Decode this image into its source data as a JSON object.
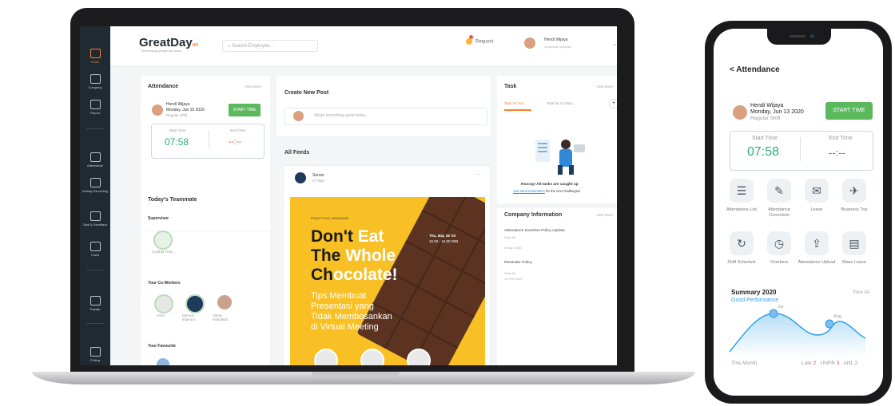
{
  "laptop": {
    "sidebar": [
      {
        "label": "Home",
        "active": true
      },
      {
        "label": "Company",
        "active": false
      },
      {
        "label": "Report",
        "active": false
      },
      {
        "label": "Attendance",
        "active": false
      },
      {
        "label": "Activity Recording",
        "active": false
      },
      {
        "label": "Task & Feedback",
        "active": false
      },
      {
        "label": "Claim",
        "active": false
      },
      {
        "label": "Payslip",
        "active": false
      },
      {
        "label": "Polling",
        "active": false
      }
    ],
    "header": {
      "logo": "GreatDay",
      "logo_mark": "HR",
      "logo_sub": "The everyday people care about",
      "search_placeholder": "Search Employee...",
      "request_label": "Request",
      "user_name": "Hendi Wijaya",
      "user_role": "Graphical Designer"
    },
    "attendance": {
      "title": "Attendance",
      "view_more": "View More",
      "name": "Hendi Wijaya",
      "date": "Monday, Jun 15 2020",
      "shift": "Regular Shift",
      "start_button": "START TIME",
      "start_label": "Start Time",
      "start_value": "07:58",
      "end_label": "End Time",
      "end_value": "--:--"
    },
    "teammate": {
      "title": "Today's Teammate",
      "supervisor_label": "Supervisor",
      "supervisor_name": "Cynthia Tirta...",
      "coworkers_label": "Your Co-Workers",
      "coworkers": [
        "Irsan",
        "Monica khairuni...",
        "Varna Harbaktio"
      ],
      "favourite_label": "Your Favourite"
    },
    "feed": {
      "create_title": "Create New Post",
      "create_placeholder": "Share something great today...",
      "all_feeds": "All Feeds",
      "poster_name": "Seruni",
      "poster_date": "27 May",
      "more": "...",
      "promo_tag": "PRACTICAL WEBINAR",
      "promo_line1_dark": "Don't",
      "promo_line1_white": "Eat",
      "promo_line2_dark": "The",
      "promo_line2_white": "Whole",
      "promo_line3_dark": "Ch",
      "promo_line3_white": "ocolate!",
      "promo_sub1": "Tips Membuat",
      "promo_sub2": "Presentasi yang",
      "promo_sub3": "Tidak Membosankan",
      "promo_sub4": "di Virtual Meeting",
      "promo_date": "Thu, May 28 '20",
      "promo_time": "15.00 - 16.00 WIB"
    },
    "task": {
      "title": "Task",
      "view_more": "View More",
      "tab_you": "Task for You",
      "tab_coworkers": "Task for Co-Wor...",
      "caught_up": "Hooray! All tasks are caught up",
      "caught_sub_link": "Just send teammates",
      "caught_sub_rest": "for the next challenges!",
      "company_title": "Company Information",
      "company_view": "View More",
      "items": [
        {
          "title": "Attendance Incentive Policy Update",
          "who": "Dear All,",
          "date": "09 Apr 2020"
        },
        {
          "title": "Reminder Policy",
          "who": "Dear All,",
          "date": "13 Feb 2019"
        }
      ]
    }
  },
  "phone": {
    "title": "< Attendance",
    "name": "Hendi Wijaya",
    "date": "Monday, Jun 13 2020",
    "shift": "Regular Shift",
    "start_button": "START TIME",
    "start_label": "Start Time",
    "start_value": "07:58",
    "end_label": "End Time",
    "end_value": "--:--",
    "features": [
      {
        "icon": "attendance-list-icon",
        "glyph": "☰",
        "label": "Attendance List"
      },
      {
        "icon": "attendance-correction-icon",
        "glyph": "✎",
        "label": "Attendance Correction"
      },
      {
        "icon": "leave-icon",
        "glyph": "✉",
        "label": "Leave"
      },
      {
        "icon": "business-trip-icon",
        "glyph": "✈",
        "label": "Business Trip"
      },
      {
        "icon": "shift-schedule-icon",
        "glyph": "↻",
        "label": "Shift Schedule"
      },
      {
        "icon": "overtime-icon",
        "glyph": "◷",
        "label": "Overtime"
      },
      {
        "icon": "attendance-upload-icon",
        "glyph": "⇪",
        "label": "Attendance Upload"
      },
      {
        "icon": "mass-leave-icon",
        "glyph": "▤",
        "label": "Mass Leave"
      }
    ],
    "summary_title": "Summary 2020",
    "summary_view": "View All",
    "summary_status": "Good Performance",
    "summary_points": [
      "Jul",
      "Aug"
    ],
    "this_month": "This Month",
    "late_label": "Late",
    "late_value": "2",
    "unpr_label": "UNPR",
    "unpr_value": "3",
    "anl_label": "ANL",
    "anl_value": "2"
  },
  "colors": {
    "accent": "#ff7f2a",
    "green": "#5cb85c",
    "time": "#2ab07a",
    "dash": "#e0443e",
    "sidebar": "#1f2a33",
    "phone_accent": "#2f9fe8"
  }
}
